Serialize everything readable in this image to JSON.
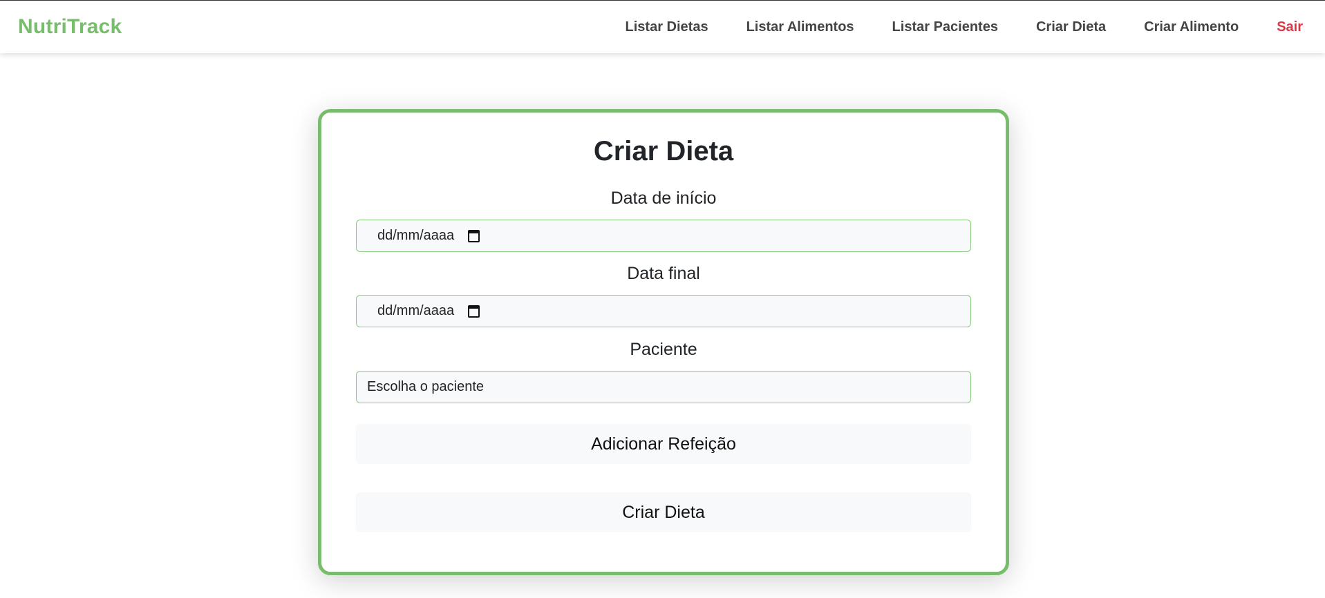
{
  "brand": "NutriTrack",
  "nav": {
    "items": [
      "Listar Dietas",
      "Listar Alimentos",
      "Listar Pacientes",
      "Criar Dieta",
      "Criar Alimento"
    ],
    "logout": "Sair"
  },
  "form": {
    "title": "Criar Dieta",
    "start_label": "Data de início",
    "start_value": "dd/mm/aaaa",
    "end_label": "Data final",
    "end_value": "dd/mm/aaaa",
    "patient_label": "Paciente",
    "patient_value": "Escolha o paciente",
    "add_meal_button": "Adicionar Refeição",
    "submit_button": "Criar Dieta"
  },
  "colors": {
    "brand": "#77bd6b",
    "logout": "#dc3545",
    "card_border": "#77bd6b"
  }
}
